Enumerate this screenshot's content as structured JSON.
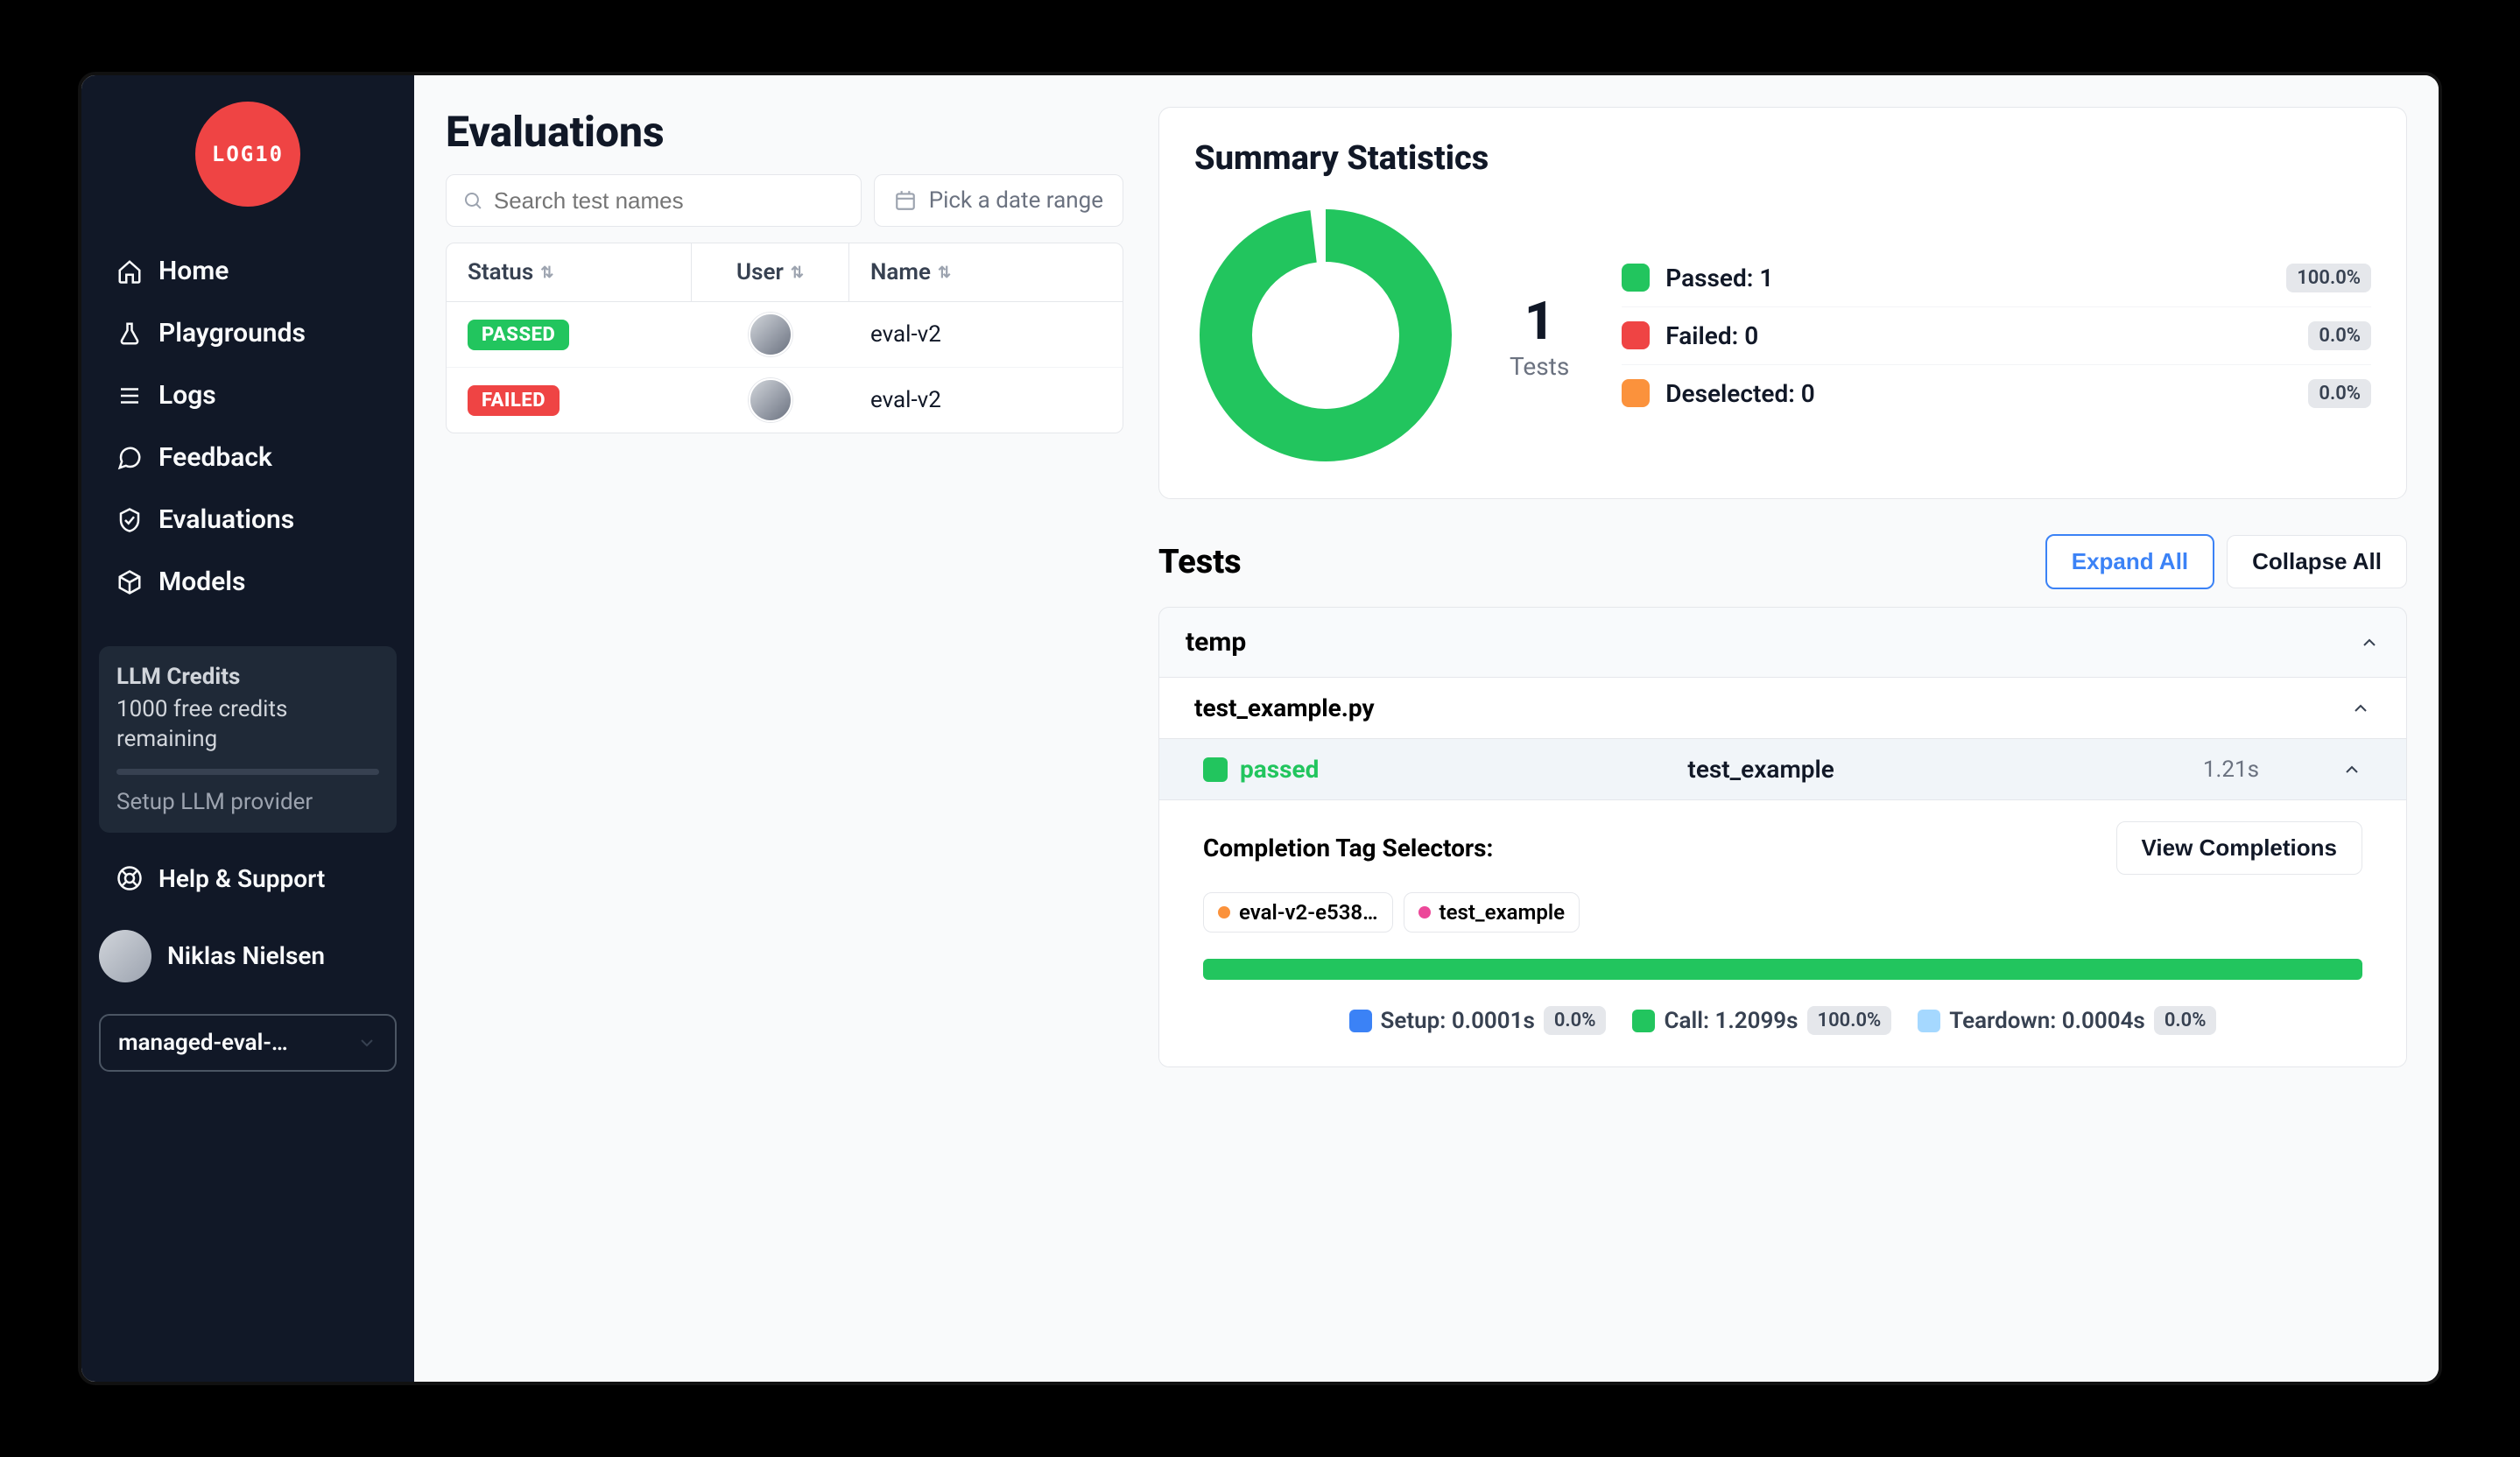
{
  "chart_data": {
    "type": "pie",
    "title": "Summary Statistics",
    "series": [
      {
        "name": "Passed",
        "value": 1,
        "color": "#22c55e"
      }
    ],
    "total": 1,
    "breakdown": [
      {
        "label": "Passed",
        "count": 1,
        "percent": "100.0%"
      },
      {
        "label": "Failed",
        "count": 0,
        "percent": "0.0%"
      },
      {
        "label": "Deselected",
        "count": 0,
        "percent": "0.0%"
      }
    ]
  },
  "logo": "LOG10",
  "nav": {
    "home": "Home",
    "playgrounds": "Playgrounds",
    "logs": "Logs",
    "feedback": "Feedback",
    "evaluations": "Evaluations",
    "models": "Models"
  },
  "credits": {
    "title": "LLM Credits",
    "subtitle": "1000 free credits remaining",
    "setup_link": "Setup LLM provider"
  },
  "help_label": "Help & Support",
  "user": {
    "name": "Niklas Nielsen"
  },
  "project_select": "managed-eval-…",
  "page": {
    "title": "Evaluations",
    "search_placeholder": "Search test names",
    "date_placeholder": "Pick a date range"
  },
  "table": {
    "headers": {
      "status": "Status",
      "user": "User",
      "name": "Name"
    },
    "rows": [
      {
        "status": "PASSED",
        "status_class": "passed",
        "name": "eval-v2"
      },
      {
        "status": "FAILED",
        "status_class": "failed",
        "name": "eval-v2"
      }
    ]
  },
  "summary": {
    "title": "Summary Statistics",
    "tests_count": "1",
    "tests_label": "Tests",
    "stats": {
      "passed": {
        "label": "Passed: 1",
        "pct": "100.0%"
      },
      "failed": {
        "label": "Failed: 0",
        "pct": "0.0%"
      },
      "deselected": {
        "label": "Deselected: 0",
        "pct": "0.0%"
      }
    }
  },
  "tests": {
    "title": "Tests",
    "expand_label": "Expand All",
    "collapse_label": "Collapse All",
    "folder": "temp",
    "file": "test_example.py",
    "test": {
      "status": "passed",
      "name": "test_example",
      "duration": "1.21s"
    },
    "details": {
      "selectors_title": "Completion Tag Selectors:",
      "view_completions": "View Completions",
      "tag1": "eval-v2-e538…",
      "tag2": "test_example",
      "timing": {
        "setup": {
          "label": "Setup: 0.0001s",
          "pct": "0.0%"
        },
        "call": {
          "label": "Call: 1.2099s",
          "pct": "100.0%"
        },
        "teardown": {
          "label": "Teardown: 0.0004s",
          "pct": "0.0%"
        }
      }
    }
  }
}
